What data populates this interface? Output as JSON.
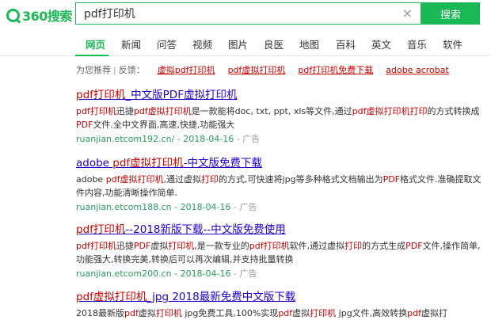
{
  "logo": {
    "text": "360搜索"
  },
  "search": {
    "query": "pdf打印机",
    "button_label": "搜索",
    "clear_glyph": "×"
  },
  "nav": [
    "网页",
    "新闻",
    "问答",
    "视频",
    "图片",
    "良医",
    "地图",
    "百科",
    "英文",
    "音乐",
    "软件"
  ],
  "suggest": {
    "label": "为您推荐",
    "sep": "|",
    "feedback": "反馈：",
    "links": [
      "虚拟pdf打印机",
      "pdf虚拟打印机",
      "pdf打印机免费下载",
      "adobe acrobat"
    ]
  },
  "results": [
    {
      "title": [
        "pdf打印机",
        "_",
        "中文版PDF虚拟打印机"
      ],
      "desc": [
        "pdf打印机",
        "迅捷",
        "pdf虚拟打印机",
        "是一款能将doc, txt, ppt, xls等文件,通过",
        "pdf虚拟打印机打印",
        "的方式转换成",
        "PDF",
        "文件.全中文界面,高速,快捷,功能强大"
      ],
      "url": "ruanjian.etcom192.cn/ - 2018-04-16",
      "ad": "- 广告"
    },
    {
      "title": [
        "adobe ",
        "pdf虚拟打印机",
        "-中文版免费下载"
      ],
      "desc": [
        "adobe ",
        "pdf虚拟打印机",
        ",通过虚拟",
        "打印",
        "的方式,可快速将jpg等多种格式文档输出为",
        "PDF",
        "格式文件.准确提取文件内容,功能清晰操作简单."
      ],
      "url": "ruanjian.etcom188.cn - 2018-04-16",
      "ad": "- 广告"
    },
    {
      "title": [
        "pdf打印机",
        "--2018新版下载--中文版免费使用"
      ],
      "desc": [
        "pdf打印机",
        "迅捷",
        "PDF",
        "虚拟",
        "打印机",
        ",是一款专业的",
        "pdf打印机",
        "软件,通过虚拟",
        "打印",
        "的方式生成",
        "PDF",
        "文件,操作简单,功能强大,转换完美,转换后可以再次编辑,并支持批量转换"
      ],
      "url": "ruanjian.etcom200.cn - 2018-04-16",
      "ad": "- 广告"
    },
    {
      "title": [
        "pdf虚拟打印机",
        "_jpg 2018最新免费中文版下载"
      ],
      "desc": [
        "2018最新版",
        "pdf",
        "虚拟",
        "打印机",
        " jpg免费工具,100%实现",
        "pdf",
        "虚拟",
        "打印机",
        " jpg文件,高效转换",
        "pdf",
        "虚拟打"
      ],
      "url": "",
      "ad": ""
    }
  ]
}
